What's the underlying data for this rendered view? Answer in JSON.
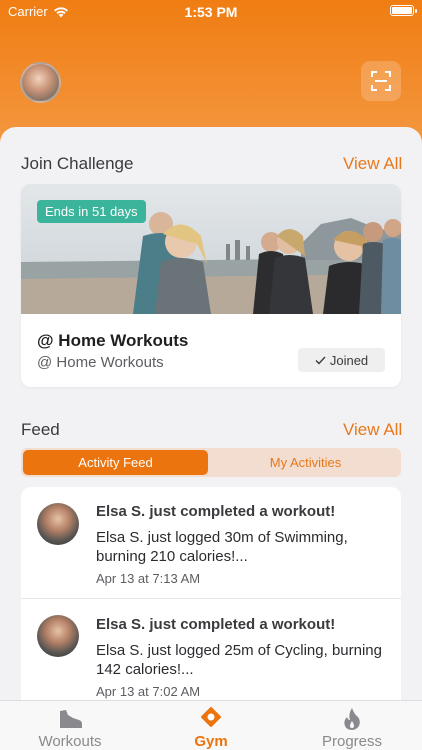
{
  "status_bar": {
    "carrier": "Carrier",
    "time": "1:53 PM"
  },
  "header": {
    "avatar_icon": "profile-avatar",
    "scan_icon": "scan-icon"
  },
  "challenges": {
    "title": "Join Challenge",
    "view_all": "View All",
    "card": {
      "badge": "Ends in 51 days",
      "title": "@ Home Workouts",
      "subtitle": "@ Home Workouts",
      "status": "Joined"
    }
  },
  "feed": {
    "title": "Feed",
    "view_all": "View All",
    "tabs": [
      {
        "label": "Activity Feed",
        "active": true
      },
      {
        "label": "My Activities",
        "active": false
      }
    ],
    "items": [
      {
        "title": "Elsa S. just completed a workout!",
        "body": "Elsa S. just logged 30m of Swimming, burning 210 calories!...",
        "time": "Apr 13 at 7:13 AM"
      },
      {
        "title": "Elsa S. just completed a workout!",
        "body": "Elsa S. just logged 25m of Cycling, burning 142 calories!...",
        "time": "Apr 13 at 7:02 AM"
      }
    ]
  },
  "tabbar": {
    "items": [
      {
        "label": "Workouts",
        "icon": "shoe-icon",
        "active": false
      },
      {
        "label": "Gym",
        "icon": "location-pin-icon",
        "active": true
      },
      {
        "label": "Progress",
        "icon": "flame-icon",
        "active": false
      }
    ]
  },
  "colors": {
    "accent": "#ec740f",
    "badge_green": "#3ab49a",
    "background": "#f2f2f4"
  }
}
